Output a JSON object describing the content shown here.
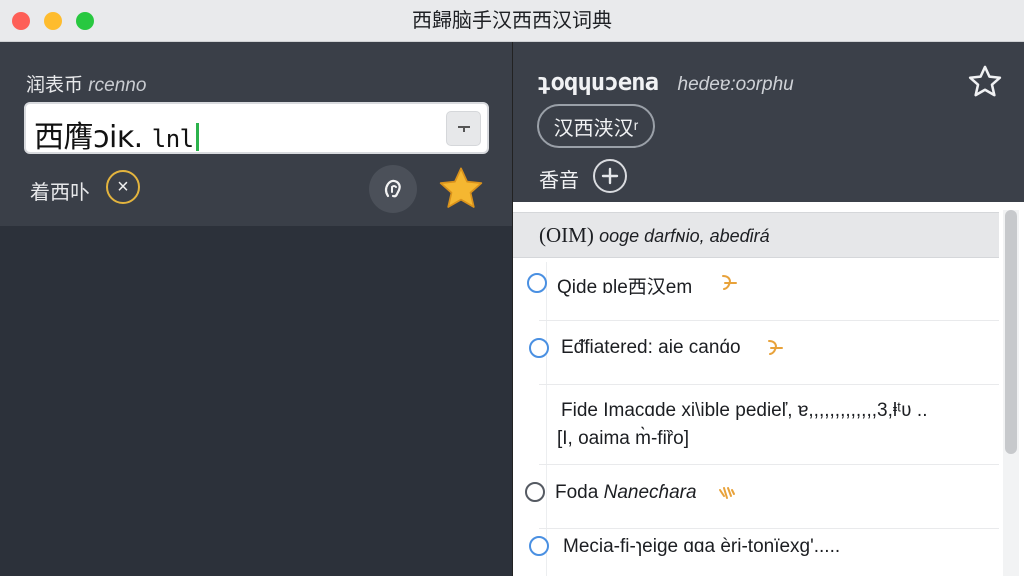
{
  "window": {
    "title": "西歸脑手汉西西汉词典"
  },
  "left": {
    "search_label": "润表币",
    "search_label_sub": "rcenno",
    "search_value": "西膺ɔiĸ.",
    "search_value_tail": "lnl",
    "filter_label": "着西卟",
    "clear_symbol": "×"
  },
  "right": {
    "word": "ʇoqɥuɔena",
    "pronunciation": "hedeɐ:oɔrphu",
    "lang_pill": "汉西浃汉ʳ",
    "audio_label": "香音",
    "results_header": "(OIM)",
    "results_header_sub": "ooge darfɴio, abeɗirá",
    "items": [
      {
        "text": "Qide ɒle西汉em"
      },
      {
        "text": "Eᵭfiatered: aie canɑ́o"
      },
      {
        "text": "Fide Imacɑde xi\\ible pedieľ, ɐ,,,,,,,,,,,,,3,ⱡᵗʋ ..",
        "text2": "[I, oaima m̀-fiȑo]"
      },
      {
        "text": "Foda",
        "text_italic": "Nanecɦara"
      },
      {
        "text": "Mecia-fi-ɿeige ɑɑa ѐri-tonïexɡ'....."
      }
    ]
  },
  "colors": {
    "accent_gold": "#e3b43e",
    "radio_blue": "#4a90e2",
    "caret_green": "#2bb24c"
  }
}
